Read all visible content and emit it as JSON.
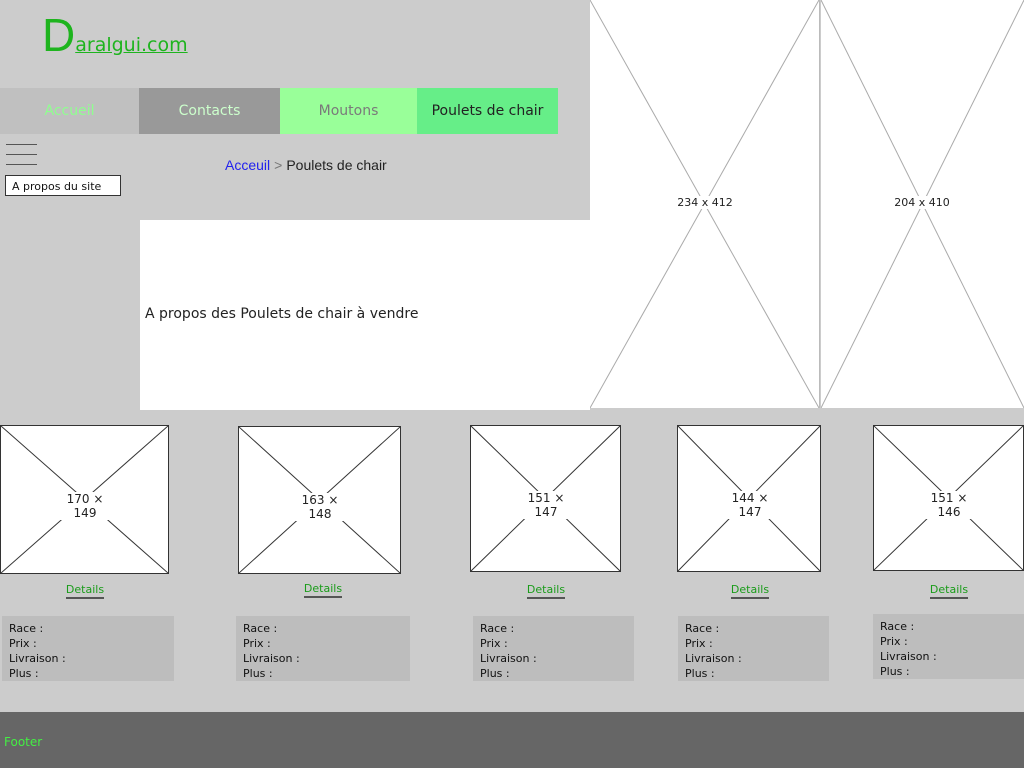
{
  "logo": {
    "initial": "D",
    "rest": "aralgui.com"
  },
  "nav": {
    "home": "Accueil",
    "contacts": "Contacts",
    "moutons": "Moutons",
    "poulets": "Poulets de chair"
  },
  "sidebar": {
    "about_button": "A propos du site"
  },
  "breadcrumb": {
    "link": "Acceuil",
    "separator": ">",
    "current": "Poulets de chair"
  },
  "main": {
    "about_text": "A propos des Poulets de chair à vendre"
  },
  "banners": [
    {
      "label": "234 x 412"
    },
    {
      "label": "204 x 410"
    }
  ],
  "products": [
    {
      "image_label": "170 × 149",
      "details": "Details",
      "race": "Race :",
      "prix": "Prix :",
      "livraison": "Livraison :",
      "plus": "Plus :"
    },
    {
      "image_label": "163 × 148",
      "details": "Details",
      "race": "Race :",
      "prix": "Prix :",
      "livraison": "Livraison :",
      "plus": "Plus :"
    },
    {
      "image_label": "151 × 147",
      "details": "Details",
      "race": "Race :",
      "prix": "Prix :",
      "livraison": "Livraison :",
      "plus": "Plus :"
    },
    {
      "image_label": "144 × 147",
      "details": "Details",
      "race": "Race :",
      "prix": "Prix :",
      "livraison": "Livraison :",
      "plus": "Plus :"
    },
    {
      "image_label": "151 × 146",
      "details": "Details",
      "race": "Race :",
      "prix": "Prix :",
      "livraison": "Livraison :",
      "plus": "Plus :"
    }
  ],
  "footer": {
    "text": "Footer"
  },
  "colors": {
    "accent_green": "#1eb41e",
    "footer_bg": "#666666",
    "page_bg": "#cccccc"
  }
}
